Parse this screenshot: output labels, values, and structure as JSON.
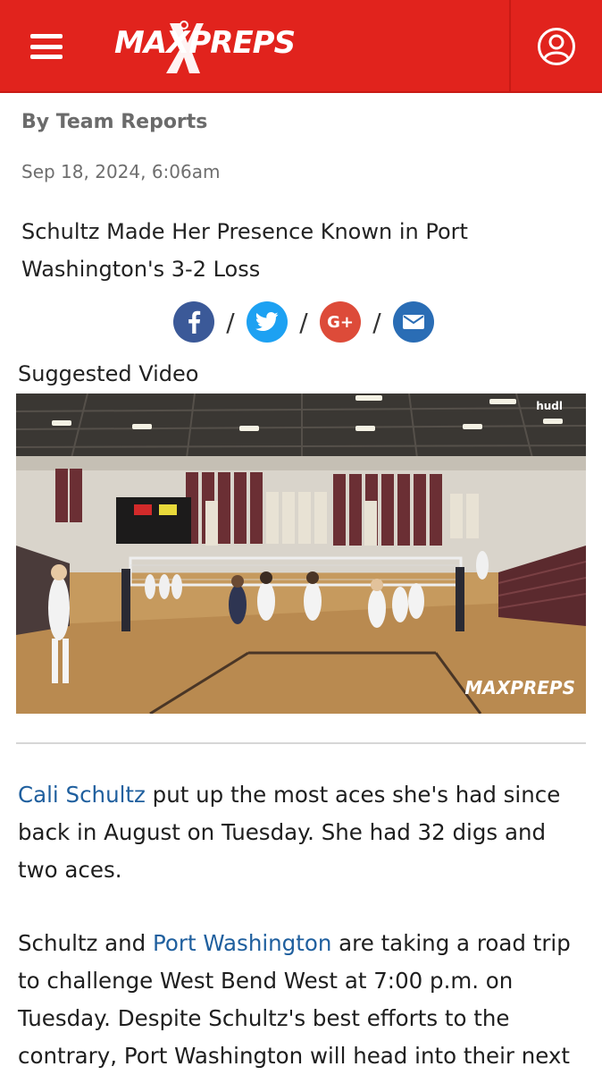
{
  "header": {
    "logo_text": "MAXPREPS",
    "colors": {
      "brand_red": "#e1231d"
    }
  },
  "article": {
    "byline": "By Team Reports",
    "date": "Sep 18, 2024, 6:06am",
    "headline": "Schultz Made Her Presence Known in Port Washington's 3-2 Loss"
  },
  "share": {
    "separator": "/",
    "icons": [
      "facebook-icon",
      "twitter-icon",
      "google-plus-icon",
      "email-icon"
    ],
    "google_plus_text": "G+",
    "colors": {
      "facebook": "#3b5998",
      "twitter": "#1da1f2",
      "google": "#dd4b39",
      "email": "#2a6db5"
    }
  },
  "video": {
    "label": "Suggested Video",
    "watermark": "hudl",
    "logo_watermark": "MAXPREPS"
  },
  "body": {
    "p1": {
      "link": "Cali Schultz",
      "text": " put up the most aces she's had since back in August on Tuesday. She had 32 digs and two aces."
    },
    "p2": {
      "start": "Schultz and ",
      "link": "Port Washington",
      "text": " are taking a road trip to challenge West Bend West at 7:00 p.m. on Tuesday. Despite Schultz's best efforts to the contrary, Port Washington will head into their next"
    }
  }
}
